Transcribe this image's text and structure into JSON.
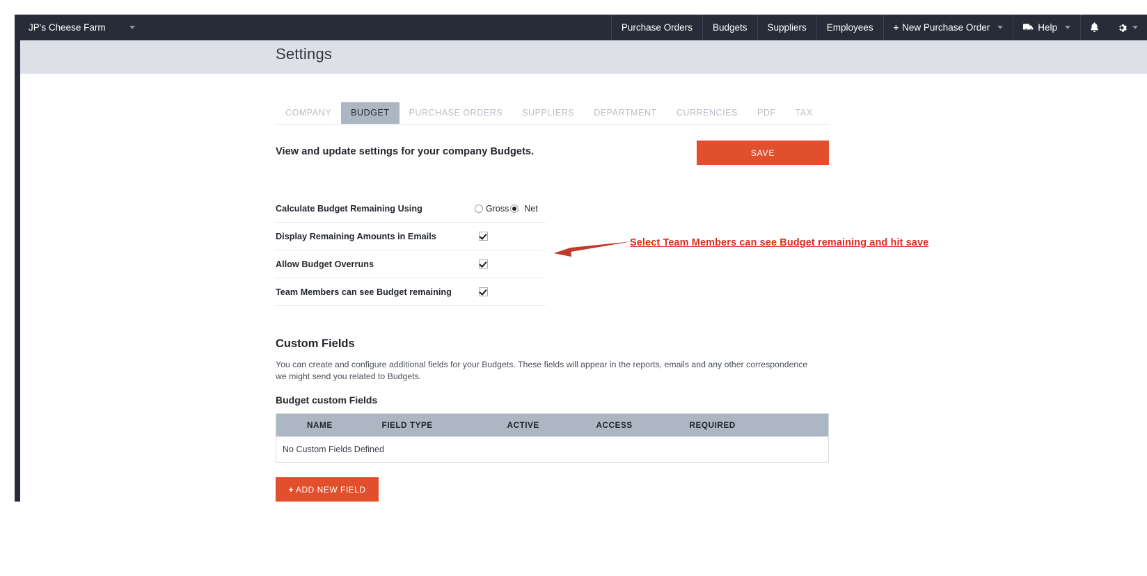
{
  "navbar": {
    "brand": "JP's Cheese Farm",
    "brand_caret_icon": "chevron-down-icon",
    "items": [
      {
        "label": "Purchase Orders",
        "icon": null,
        "caret": false
      },
      {
        "label": "Budgets",
        "icon": null,
        "caret": false
      },
      {
        "label": "Suppliers",
        "icon": null,
        "caret": false
      },
      {
        "label": "Employees",
        "icon": null,
        "caret": false
      }
    ],
    "new_po": {
      "label": "New Purchase Order",
      "plus": "+",
      "caret_icon": "chevron-down-icon"
    },
    "help": {
      "label": "Help",
      "icon": "truck-icon",
      "caret_icon": "chevron-down-icon"
    },
    "bell_icon": "bell-icon",
    "gear_icon": "gear-icon",
    "gear_caret_icon": "chevron-down-icon"
  },
  "header": {
    "title": "Settings"
  },
  "tabs": [
    {
      "label": "COMPANY",
      "active": false
    },
    {
      "label": "BUDGET",
      "active": true
    },
    {
      "label": "PURCHASE ORDERS",
      "active": false
    },
    {
      "label": "SUPPLIERS",
      "active": false
    },
    {
      "label": "DEPARTMENT",
      "active": false
    },
    {
      "label": "CURRENCIES",
      "active": false
    },
    {
      "label": "PDF",
      "active": false
    },
    {
      "label": "TAX",
      "active": false
    }
  ],
  "section": {
    "title": "View and update settings for your company Budgets.",
    "save_label": "SAVE"
  },
  "settings": {
    "calc_label": "Calculate Budget Remaining Using",
    "calc_options": [
      {
        "label": "Gross",
        "selected": false
      },
      {
        "label": "Net",
        "selected": true
      }
    ],
    "rows": [
      {
        "label": "Display Remaining Amounts in Emails",
        "checked": true
      },
      {
        "label": "Allow Budget Overruns",
        "checked": true
      },
      {
        "label": "Team Members can see Budget remaining",
        "checked": true
      }
    ]
  },
  "custom_fields": {
    "title": "Custom Fields",
    "description": "You can create and configure additional fields for your Budgets. These fields will appear in the reports, emails and any other correspondence we might send you related to Budgets.",
    "subtitle": "Budget custom Fields",
    "columns": [
      "NAME",
      "FIELD TYPE",
      "ACTIVE",
      "ACCESS",
      "REQUIRED"
    ],
    "empty_message": "No Custom Fields Defined",
    "add_button": {
      "plus": "+",
      "label": "ADD NEW FIELD"
    }
  },
  "annotation": {
    "text": "Select Team Members can see Budget remaining and hit save",
    "color": "#d6301f",
    "arrow_icon": "left-arrow-annotation"
  },
  "colors": {
    "navbar_bg": "#272c38",
    "header_band": "#dde0e7",
    "accent_orange": "#e24f2c",
    "table_header": "#adb7c4",
    "annotation_red": "#d6301f"
  }
}
